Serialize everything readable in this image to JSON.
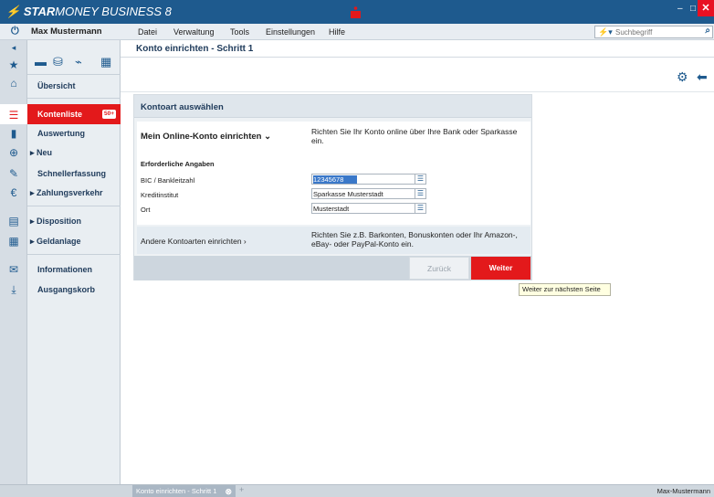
{
  "app": {
    "logo_prefix": "STAR",
    "logo_brand": "MONEY BUSINESS 8",
    "min": "–",
    "max": "□",
    "close": "✕",
    "brand_color": "#1e5a8e",
    "accent_color": "#e3191b"
  },
  "menubar": {
    "user": "Max Mustermann",
    "items": [
      "Datei",
      "Verwaltung",
      "Tools",
      "Einstellungen",
      "Hilfe"
    ],
    "search_placeholder": "Suchbegriff"
  },
  "nav": {
    "items": [
      {
        "label": "Übersicht",
        "icon": "home-icon"
      },
      {
        "label": "Kontenliste",
        "icon": "list-icon",
        "badge": "50+"
      },
      {
        "label": "Auswertung",
        "icon": "bar-chart-icon"
      },
      {
        "label": "▸ Neu",
        "icon": "new-account-icon"
      },
      {
        "label": "Schnellerfassung",
        "icon": "edit-icon"
      },
      {
        "label": "▸ Zahlungsverkehr",
        "icon": "payment-icon"
      },
      {
        "label": "▸ Disposition",
        "icon": "disposition-icon"
      },
      {
        "label": "▸ Geldanlage",
        "icon": "investment-icon"
      },
      {
        "label": "Informationen",
        "icon": "mail-icon"
      },
      {
        "label": "Ausgangskorb",
        "icon": "outbox-icon"
      }
    ]
  },
  "main": {
    "page_title": "Konto einrichten - Schritt 1",
    "panel_title": "Kontoart auswählen",
    "online": {
      "title": "Mein Online-Konto einrichten ⌄",
      "desc": "Richten Sie Ihr Konto online über Ihre Bank oder Sparkasse ein.",
      "req_title": "Erforderliche Angaben",
      "fields": [
        {
          "label": "BIC / Bankleitzahl",
          "value": "12345678"
        },
        {
          "label": "Kreditinstitut",
          "value": "Sparkasse Musterstadt"
        },
        {
          "label": "Ort",
          "value": "Musterstadt"
        }
      ]
    },
    "other": {
      "title": "Andere Kontoarten einrichten ›",
      "desc": "Richten Sie z.B. Barkonten, Bonuskonten oder Ihr Amazon-, eBay- oder PayPal-Konto ein."
    },
    "back_label": "Zurück",
    "next_label": "Weiter",
    "tooltip": "Weiter zur nächsten Seite"
  },
  "statusbar": {
    "tab_label": "Konto einrichten - Schritt 1",
    "plus": "+",
    "user": "Max-Mustermann"
  }
}
